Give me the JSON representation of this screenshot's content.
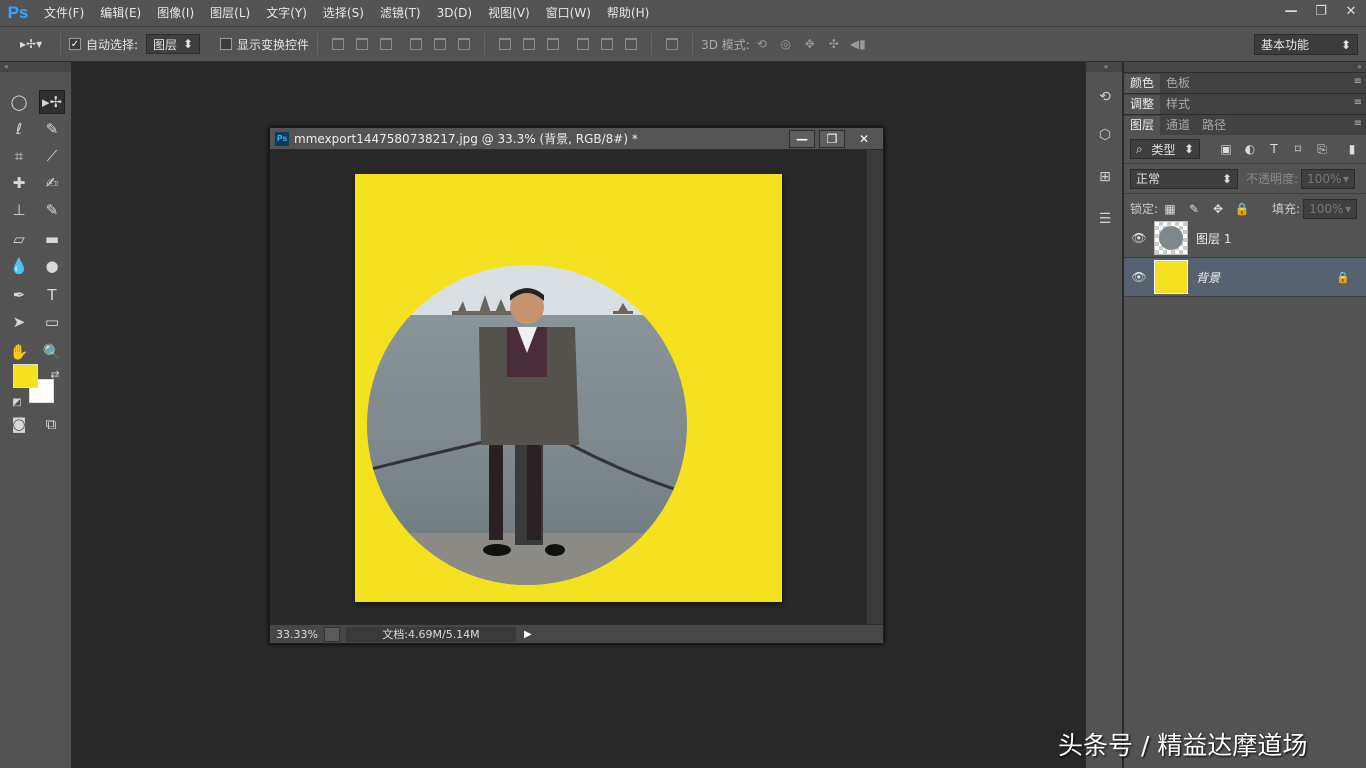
{
  "app": {
    "logo": "Ps"
  },
  "menu": [
    "文件(F)",
    "编辑(E)",
    "图像(I)",
    "图层(L)",
    "文字(Y)",
    "选择(S)",
    "滤镜(T)",
    "3D(D)",
    "视图(V)",
    "窗口(W)",
    "帮助(H)"
  ],
  "window_controls": [
    "—",
    "❐",
    "✕"
  ],
  "options": {
    "auto_select_label": "自动选择:",
    "auto_select_value": "图层",
    "show_transform_label": "显示变换控件",
    "mode3d_label": "3D 模式:",
    "workspace": "基本功能"
  },
  "tools": [
    {
      "name": "elliptical-marquee-tool",
      "glyph": "◯"
    },
    {
      "name": "move-tool",
      "glyph": "▸✢"
    },
    {
      "name": "lasso-tool",
      "glyph": "ℓ"
    },
    {
      "name": "quick-selection-tool",
      "glyph": "✎"
    },
    {
      "name": "crop-tool",
      "glyph": "⌗"
    },
    {
      "name": "eyedropper-tool",
      "glyph": "⟋"
    },
    {
      "name": "healing-brush-tool",
      "glyph": "✚"
    },
    {
      "name": "brush-tool",
      "glyph": "✍"
    },
    {
      "name": "clone-stamp-tool",
      "glyph": "⊥"
    },
    {
      "name": "history-brush-tool",
      "glyph": "✎"
    },
    {
      "name": "eraser-tool",
      "glyph": "▱"
    },
    {
      "name": "gradient-tool",
      "glyph": "▬"
    },
    {
      "name": "blur-tool",
      "glyph": "💧"
    },
    {
      "name": "dodge-tool",
      "glyph": "●"
    },
    {
      "name": "pen-tool",
      "glyph": "✒"
    },
    {
      "name": "type-tool",
      "glyph": "T"
    },
    {
      "name": "path-selection-tool",
      "glyph": "➤"
    },
    {
      "name": "rectangle-tool",
      "glyph": "▭"
    },
    {
      "name": "hand-tool",
      "glyph": "✋"
    },
    {
      "name": "zoom-tool",
      "glyph": "🔍"
    }
  ],
  "colors": {
    "foreground": "#f4e221",
    "background": "#ffffff",
    "canvas": "#f4e221"
  },
  "document": {
    "title": "mmexport1447580738217.jpg @ 33.3% (背景, RGB/8#) *",
    "zoom": "33.33%",
    "size": "文档:4.69M/5.14M"
  },
  "panels": {
    "row1_tabs": [
      "颜色",
      "色板"
    ],
    "row2_tabs": [
      "调整",
      "样式"
    ],
    "row3_tabs": [
      "图层",
      "通道",
      "路径"
    ],
    "filter_type": "类型",
    "blend_mode": "正常",
    "opacity_label": "不透明度:",
    "opacity_value": "100%",
    "lock_label": "锁定:",
    "fill_label": "填充:",
    "fill_value": "100%",
    "layers": [
      {
        "name": "图层 1",
        "selected": false
      },
      {
        "name": "背景",
        "selected": true
      }
    ]
  },
  "watermark": "头条号 / 精益达摩道场"
}
